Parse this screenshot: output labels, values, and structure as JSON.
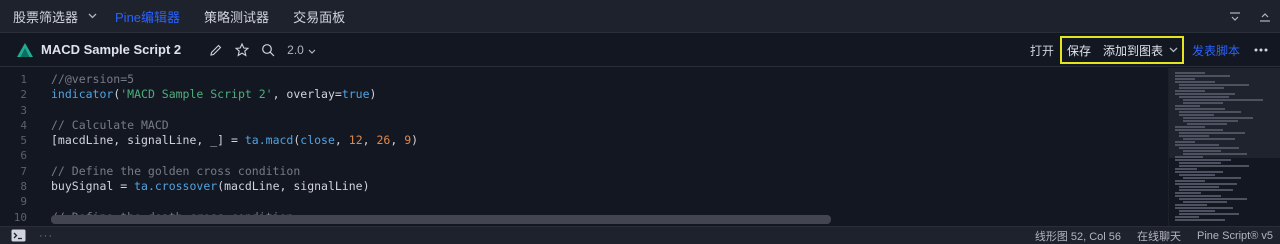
{
  "tabs": [
    {
      "label": "股票筛选器",
      "active": false
    },
    {
      "label": "Pine编辑器",
      "active": true
    },
    {
      "label": "策略测试器",
      "active": false
    },
    {
      "label": "交易面板",
      "active": false
    }
  ],
  "toolbar": {
    "script_title": "MACD Sample Script 2",
    "version": "2.0",
    "open_label": "打开",
    "save_label": "保存",
    "add_to_chart_label": "添加到图表",
    "publish_label": "发表脚本"
  },
  "code_lines": [
    "//@version=5",
    "indicator('MACD Sample Script 2', overlay=true)",
    "",
    "// Calculate MACD",
    "[macdLine, signalLine, _] = ta.macd(close, 12, 26, 9)",
    "",
    "// Define the golden cross condition",
    "buySignal = ta.crossover(macdLine, signalLine)",
    "",
    "// Define the death cross condition"
  ],
  "line_numbers": [
    "1",
    "2",
    "3",
    "4",
    "5",
    "6",
    "7",
    "8",
    "9",
    "10"
  ],
  "status": {
    "cursor": "线形图 52, Col 56",
    "chat": "在线聊天",
    "language": "Pine Script® v5"
  },
  "colors": {
    "accent": "#2962ff",
    "highlight_box": "#e5e51f",
    "background": "#131722"
  }
}
